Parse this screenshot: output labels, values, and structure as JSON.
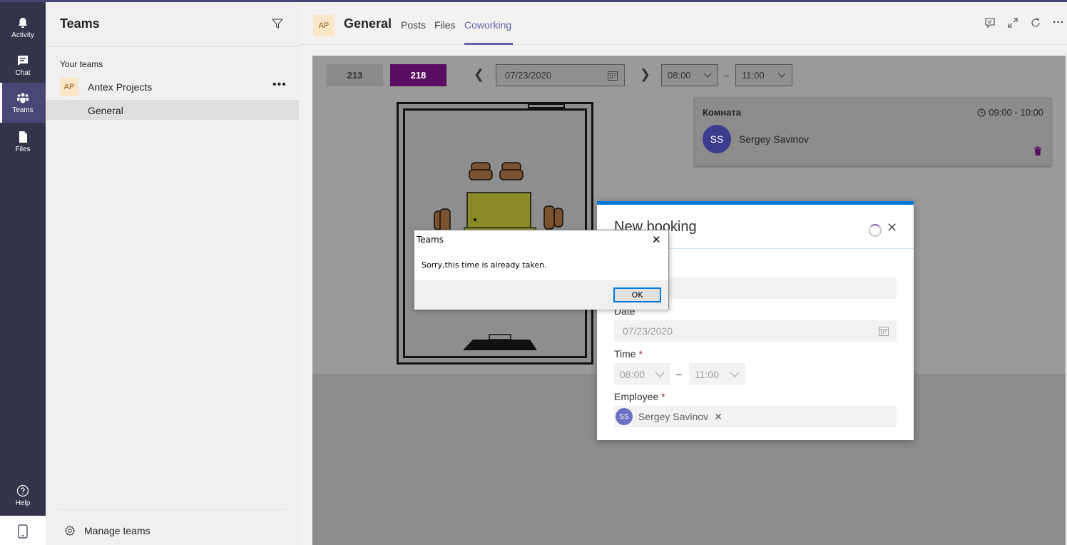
{
  "rail": {
    "items": [
      {
        "label": "Activity",
        "icon": "bell-icon"
      },
      {
        "label": "Chat",
        "icon": "chat-icon"
      },
      {
        "label": "Teams",
        "icon": "teams-icon"
      },
      {
        "label": "Files",
        "icon": "file-icon"
      }
    ],
    "help_label": "Help"
  },
  "left_panel": {
    "title": "Teams",
    "section_label": "Your teams",
    "team": {
      "avatar": "AP",
      "name": "Antex Projects",
      "more": "•••"
    },
    "channel": {
      "name": "General"
    },
    "manage_label": "Manage teams"
  },
  "header": {
    "avatar": "AP",
    "title": "General",
    "tabs": [
      {
        "label": "Posts"
      },
      {
        "label": "Files"
      },
      {
        "label": "Coworking"
      }
    ],
    "more": "···"
  },
  "toolbar": {
    "rooms": [
      "213",
      "218"
    ],
    "date": "07/23/2020",
    "time_from": "08:00",
    "time_to": "11:00",
    "dash": "–"
  },
  "booking_card": {
    "room": "Комната",
    "time": "09:00 - 10:00",
    "initials": "SS",
    "name": "Sergey Savinov"
  },
  "new_booking": {
    "title": "New booking",
    "date_label": "Date",
    "date_value": "07/23/2020",
    "time_label": "Time",
    "required_mark": "*",
    "time_from": "08:00",
    "time_to": "11:00",
    "dash": "–",
    "employee_label": "Employee",
    "employee_initials": "SS",
    "employee_name": "Sergey Savinov"
  },
  "alert": {
    "title": "Teams",
    "message": "Sorry,this time is already taken.",
    "ok_label": "OK"
  },
  "colors": {
    "rail": "#33344a",
    "brand": "#6264a7",
    "room_selected": "#5a0e63",
    "panel_accent": "#0078d4"
  }
}
